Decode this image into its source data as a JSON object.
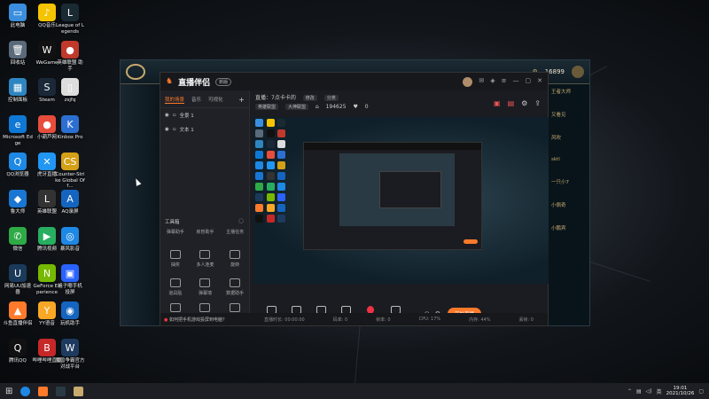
{
  "desktop_icons": [
    {
      "label": "此电脑",
      "color": "#3b8ede",
      "glyph": "▭"
    },
    {
      "label": "QQ音乐",
      "color": "#f5c400",
      "glyph": "♪"
    },
    {
      "label": "League of Legends",
      "color": "#1a2a33",
      "glyph": "L"
    },
    {
      "label": "回收站",
      "color": "#5a6a7a",
      "glyph": "🗑"
    },
    {
      "label": "WeGame",
      "color": "#111111",
      "glyph": "W"
    },
    {
      "label": "英雄联盟 助手",
      "color": "#c0392b",
      "glyph": "●"
    },
    {
      "label": "控制面板",
      "color": "#2e86c1",
      "glyph": "▦"
    },
    {
      "label": "Steam",
      "color": "#1b2838",
      "glyph": "S"
    },
    {
      "label": "zsjfq",
      "color": "#dddddd",
      "glyph": "▯"
    },
    {
      "label": "Microsoft Edge",
      "color": "#0f78d4",
      "glyph": "e"
    },
    {
      "label": "小葫芦网",
      "color": "#e74c3c",
      "glyph": "●"
    },
    {
      "label": "Kinbox Pro",
      "color": "#2c6fd1",
      "glyph": "K"
    },
    {
      "label": "QQ浏览器",
      "color": "#1e88e5",
      "glyph": "Q"
    },
    {
      "label": "虎牙直播",
      "color": "#2196f3",
      "glyph": "✕"
    },
    {
      "label": "Counter-Strike Global Off...",
      "color": "#d4a017",
      "glyph": "CS"
    },
    {
      "label": "鲁大师",
      "color": "#1976d2",
      "glyph": "◆"
    },
    {
      "label": "英雄联盟",
      "color": "#333333",
      "glyph": "L"
    },
    {
      "label": "AQ录屏",
      "color": "#1565c0",
      "glyph": "A"
    },
    {
      "label": "微信",
      "color": "#2eaa47",
      "glyph": "✆"
    },
    {
      "label": "腾讯视频",
      "color": "#27ae60",
      "glyph": "▶"
    },
    {
      "label": "暴风影音",
      "color": "#1e88e5",
      "glyph": "◎"
    },
    {
      "label": "网易UU加速器",
      "color": "#1b3a5a",
      "glyph": "U"
    },
    {
      "label": "GeForce Experience",
      "color": "#76b900",
      "glyph": "N"
    },
    {
      "label": "格子嘟手机 投屏",
      "color": "#2962ff",
      "glyph": "▣"
    },
    {
      "label": "斗鱼直播伴侣",
      "color": "#ff7a2a",
      "glyph": "▲"
    },
    {
      "label": "YY语音",
      "color": "#f9a825",
      "glyph": "Y"
    },
    {
      "label": "玩机助手",
      "color": "#1565c0",
      "glyph": "◉"
    },
    {
      "label": "腾讯QQ",
      "color": "#111111",
      "glyph": "Q"
    },
    {
      "label": "哔哩哔哩直播",
      "color": "#c62828",
      "glyph": "B"
    },
    {
      "label": "魔兽争霸官方 对战平台",
      "color": "#1e3a5f",
      "glyph": "W"
    }
  ],
  "game_window": {
    "points": "16899",
    "side_items": [
      "王者大师",
      "又看见",
      "风吹",
      "sktl",
      "一只小7",
      "小佩奇",
      "小鹏宾"
    ]
  },
  "app": {
    "logo_text": "直播伴侣",
    "version_badge": "新版",
    "tabs": [
      "我的场景",
      "音乐",
      "可视化"
    ],
    "scenes": [
      "全景 1",
      "文本 1"
    ],
    "tools_title": "工具箱",
    "tools_row1": [
      "弹幕助手",
      "房管助手",
      "主播任务"
    ],
    "tools_row2": [
      "抽奖",
      "多人连麦",
      "旋转"
    ],
    "tools_row3": [
      "道具贴",
      "弹幕墙",
      "数据助手"
    ],
    "tools_row4": [
      "全民PK",
      "主播连麦",
      "上车一起玩"
    ],
    "tip_text": "如何把手机游戏投屏到电脑？",
    "stream_title_label": "直播：",
    "stream_title": "7点卡卡的",
    "edit_label": "修改",
    "category_label": "分类",
    "chip_game": "英雄联盟",
    "chip_zone": "大神联盟",
    "room_id": "194625",
    "viewers": "0",
    "bottom_items": [
      "直播屏幕",
      "摄像头",
      "手机投屏",
      "多媒体",
      "麦克风",
      "扬声器"
    ],
    "start_button": "开始直播",
    "stats": [
      "直播时长: 00:00:00",
      "码率: 0",
      "帧率: 0",
      "CPU: 17%",
      "内存: 44%",
      "丢帧: 0"
    ]
  },
  "taskbar": {
    "time": "19:01",
    "date": "2021/10/26",
    "lang": "英"
  }
}
